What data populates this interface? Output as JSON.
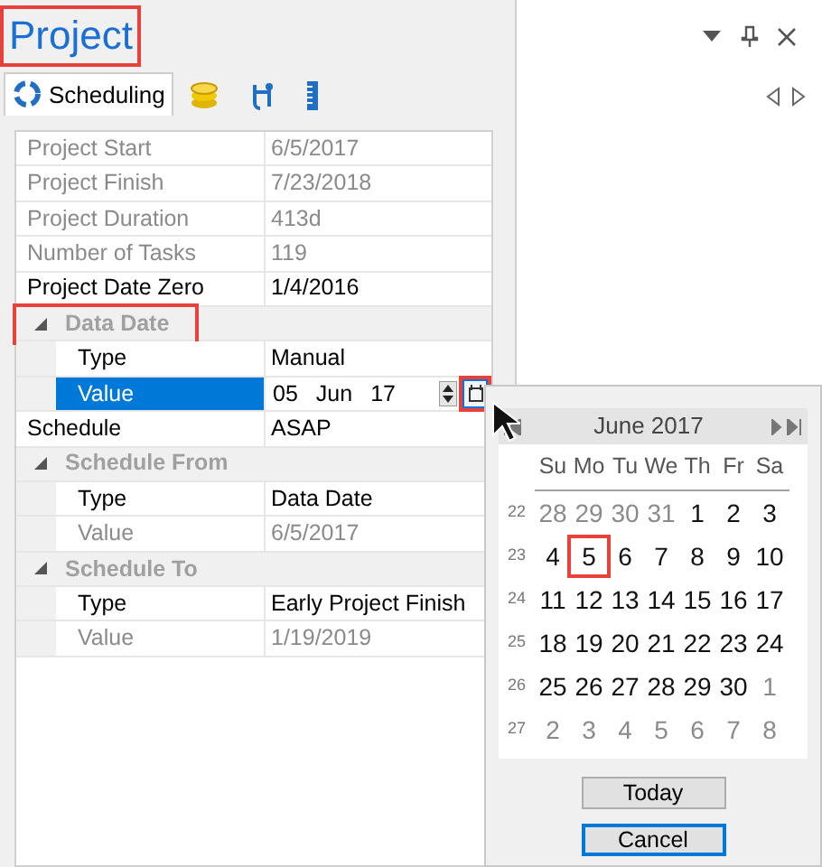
{
  "panel": {
    "title": "Project",
    "title_highlighted": true
  },
  "tabs": [
    {
      "kind": "scheduling",
      "label": "Scheduling",
      "selected": true
    },
    {
      "kind": "coins",
      "selected": false
    },
    {
      "kind": "network",
      "selected": false
    },
    {
      "kind": "ruler",
      "selected": false
    }
  ],
  "properties": [
    {
      "kind": "row",
      "label": "Project Start",
      "value": "6/5/2017",
      "readonly": true
    },
    {
      "kind": "row",
      "label": "Project Finish",
      "value": "7/23/2018",
      "readonly": true
    },
    {
      "kind": "row",
      "label": "Project Duration",
      "value": "413d",
      "readonly": true
    },
    {
      "kind": "row",
      "label": "Number of Tasks",
      "value": "119",
      "readonly": true
    },
    {
      "kind": "row",
      "label": "Project Date Zero",
      "value": "1/4/2016",
      "readonly": false
    },
    {
      "kind": "group",
      "label": "Data Date",
      "expanded": true,
      "highlighted": true,
      "children": [
        {
          "kind": "row",
          "label": "Type",
          "value": "Manual",
          "readonly": false
        },
        {
          "kind": "date-editor",
          "label": "Value",
          "selected": true,
          "day": "05",
          "month": "Jun",
          "year": "17",
          "button_highlighted": true
        }
      ]
    },
    {
      "kind": "row",
      "label": "Schedule",
      "value": "ASAP",
      "readonly": false
    },
    {
      "kind": "group",
      "label": "Schedule From",
      "expanded": true,
      "highlighted": false,
      "children": [
        {
          "kind": "row",
          "label": "Type",
          "value": "Data Date",
          "readonly": false
        },
        {
          "kind": "row",
          "label": "Value",
          "value": "6/5/2017",
          "readonly": true
        }
      ]
    },
    {
      "kind": "group",
      "label": "Schedule To",
      "expanded": true,
      "highlighted": false,
      "children": [
        {
          "kind": "row",
          "label": "Type",
          "value": "Early Project Finish",
          "readonly": false
        },
        {
          "kind": "row",
          "label": "Value",
          "value": "1/19/2019",
          "readonly": true
        }
      ]
    }
  ],
  "calendar": {
    "month": "June 2017",
    "weekdays": [
      "Su",
      "Mo",
      "Tu",
      "We",
      "Th",
      "Fr",
      "Sa"
    ],
    "weeks": [
      {
        "number": "22",
        "days": [
          {
            "label": "28",
            "other_month": true,
            "selected": false
          },
          {
            "label": "29",
            "other_month": true,
            "selected": false
          },
          {
            "label": "30",
            "other_month": true,
            "selected": false
          },
          {
            "label": "31",
            "other_month": true,
            "selected": false
          },
          {
            "label": "1",
            "other_month": false,
            "selected": false
          },
          {
            "label": "2",
            "other_month": false,
            "selected": false
          },
          {
            "label": "3",
            "other_month": false,
            "selected": false
          }
        ]
      },
      {
        "number": "23",
        "days": [
          {
            "label": "4",
            "other_month": false,
            "selected": false
          },
          {
            "label": "5",
            "other_month": false,
            "selected": true
          },
          {
            "label": "6",
            "other_month": false,
            "selected": false
          },
          {
            "label": "7",
            "other_month": false,
            "selected": false
          },
          {
            "label": "8",
            "other_month": false,
            "selected": false
          },
          {
            "label": "9",
            "other_month": false,
            "selected": false
          },
          {
            "label": "10",
            "other_month": false,
            "selected": false
          }
        ]
      },
      {
        "number": "24",
        "days": [
          {
            "label": "11",
            "other_month": false,
            "selected": false
          },
          {
            "label": "12",
            "other_month": false,
            "selected": false
          },
          {
            "label": "13",
            "other_month": false,
            "selected": false
          },
          {
            "label": "14",
            "other_month": false,
            "selected": false
          },
          {
            "label": "15",
            "other_month": false,
            "selected": false
          },
          {
            "label": "16",
            "other_month": false,
            "selected": false
          },
          {
            "label": "17",
            "other_month": false,
            "selected": false
          }
        ]
      },
      {
        "number": "25",
        "days": [
          {
            "label": "18",
            "other_month": false,
            "selected": false
          },
          {
            "label": "19",
            "other_month": false,
            "selected": false
          },
          {
            "label": "20",
            "other_month": false,
            "selected": false
          },
          {
            "label": "21",
            "other_month": false,
            "selected": false
          },
          {
            "label": "22",
            "other_month": false,
            "selected": false
          },
          {
            "label": "23",
            "other_month": false,
            "selected": false
          },
          {
            "label": "24",
            "other_month": false,
            "selected": false
          }
        ]
      },
      {
        "number": "26",
        "days": [
          {
            "label": "25",
            "other_month": false,
            "selected": false
          },
          {
            "label": "26",
            "other_month": false,
            "selected": false
          },
          {
            "label": "27",
            "other_month": false,
            "selected": false
          },
          {
            "label": "28",
            "other_month": false,
            "selected": false
          },
          {
            "label": "29",
            "other_month": false,
            "selected": false
          },
          {
            "label": "30",
            "other_month": false,
            "selected": false
          },
          {
            "label": "1",
            "other_month": true,
            "selected": false
          }
        ]
      },
      {
        "number": "27",
        "days": [
          {
            "label": "2",
            "other_month": true,
            "selected": false
          },
          {
            "label": "3",
            "other_month": true,
            "selected": false
          },
          {
            "label": "4",
            "other_month": true,
            "selected": false
          },
          {
            "label": "5",
            "other_month": true,
            "selected": false
          },
          {
            "label": "6",
            "other_month": true,
            "selected": false
          },
          {
            "label": "7",
            "other_month": true,
            "selected": false
          },
          {
            "label": "8",
            "other_month": true,
            "selected": false
          }
        ]
      }
    ],
    "buttons": [
      {
        "label": "Today",
        "focused": false
      },
      {
        "label": "Cancel",
        "focused": true
      }
    ]
  }
}
